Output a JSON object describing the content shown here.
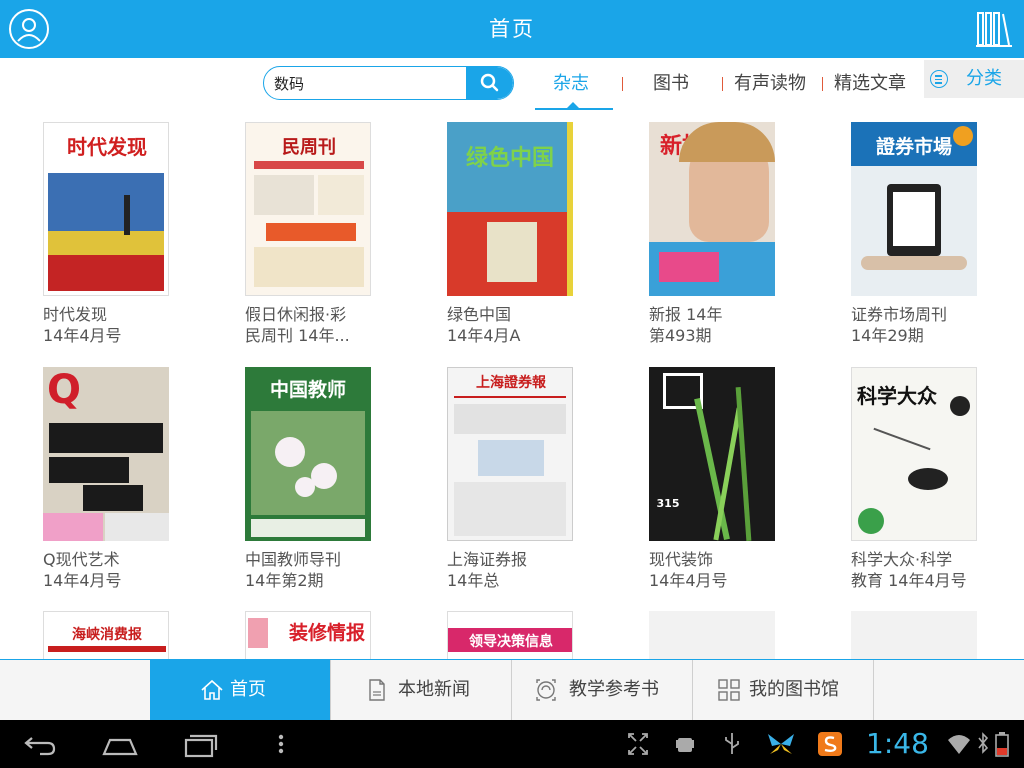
{
  "header": {
    "title": "首页",
    "user_icon": "user-icon",
    "shelf_icon": "bookshelf-icon"
  },
  "search": {
    "value": "数码"
  },
  "tabs": [
    {
      "label": "杂志",
      "active": true
    },
    {
      "label": "图书",
      "active": false
    },
    {
      "label": "有声读物",
      "active": false
    },
    {
      "label": "精选文章",
      "active": false
    }
  ],
  "category": {
    "label": "分类"
  },
  "items": [
    {
      "line1": "时代发现",
      "line2": "14年4月号",
      "mast": "时代发现"
    },
    {
      "line1": "假日休闲报·彩",
      "line2": "民周刊 14年...",
      "mast": "民周刊"
    },
    {
      "line1": "绿色中国",
      "line2": "14年4月A",
      "mast": "绿色中国"
    },
    {
      "line1": "新报 14年",
      "line2": "第493期",
      "mast": "新报"
    },
    {
      "line1": "证券市场周刊",
      "line2": "14年29期",
      "mast": "證券市場"
    },
    {
      "line1": "Q现代艺术",
      "line2": "14年4月号",
      "mast": "Q"
    },
    {
      "line1": "中国教师导刊",
      "line2": "14年第2期",
      "mast": "中国教师"
    },
    {
      "line1": "上海证券报",
      "line2": "14年总",
      "mast": "上海證券報"
    },
    {
      "line1": "现代装饰",
      "line2": "14年4月号",
      "mast": "315"
    },
    {
      "line1": "科学大众·科学",
      "line2": "教育 14年4月号",
      "mast": "科学大众"
    }
  ],
  "partial_items": [
    {
      "mast": "海峡消费报"
    },
    {
      "mast": "装修情报"
    },
    {
      "mast": "领导决策信息"
    }
  ],
  "bottom_nav": [
    {
      "label": "首页",
      "icon": "home-icon",
      "active": true
    },
    {
      "label": "本地新闻",
      "icon": "news-icon",
      "active": false
    },
    {
      "label": "教学参考书",
      "icon": "reference-book-icon",
      "active": false
    },
    {
      "label": "我的图书馆",
      "icon": "grid-library-icon",
      "active": false
    }
  ],
  "system": {
    "clock": "1:48"
  },
  "colors": {
    "accent": "#1aa5e8",
    "separator": "#e05a3a"
  }
}
